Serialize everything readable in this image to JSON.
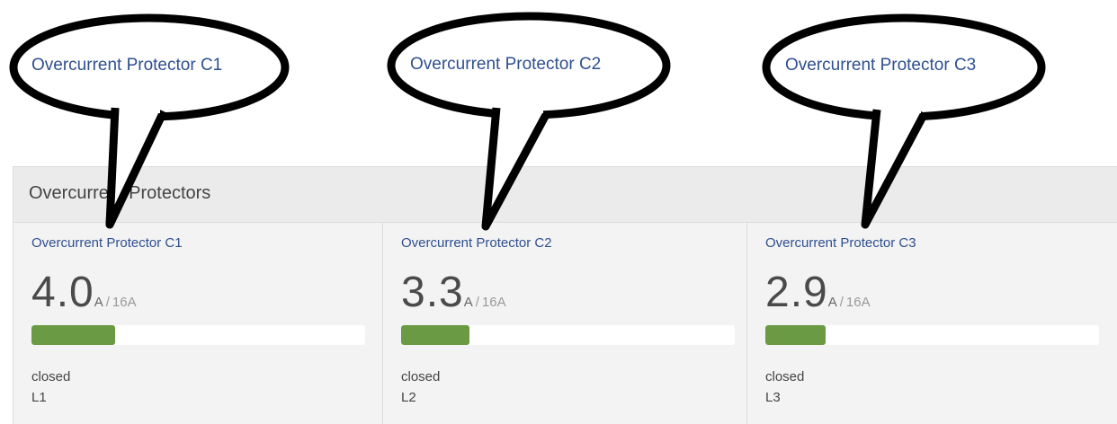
{
  "panel": {
    "title": "Overcurrent Protectors"
  },
  "protectors": [
    {
      "name": "Overcurrent Protector C1",
      "value": "4.0",
      "unit": "A",
      "separator": "/",
      "max": "16A",
      "load_fraction": 0.25,
      "state": "closed",
      "line": "L1"
    },
    {
      "name": "Overcurrent Protector C2",
      "value": "3.3",
      "unit": "A",
      "separator": "/",
      "max": "16A",
      "load_fraction": 0.206,
      "state": "closed",
      "line": "L2"
    },
    {
      "name": "Overcurrent Protector C3",
      "value": "2.9",
      "unit": "A",
      "separator": "/",
      "max": "16A",
      "load_fraction": 0.181,
      "state": "closed",
      "line": "L3"
    }
  ],
  "callouts": [
    {
      "label": "Overcurrent Protector C1"
    },
    {
      "label": "Overcurrent Protector C2"
    },
    {
      "label": "Overcurrent Protector C3"
    }
  ],
  "colors": {
    "bar_fill": "#6b9a45",
    "title_link": "#2f4f8f",
    "panel_bg": "#f3f3f3"
  }
}
